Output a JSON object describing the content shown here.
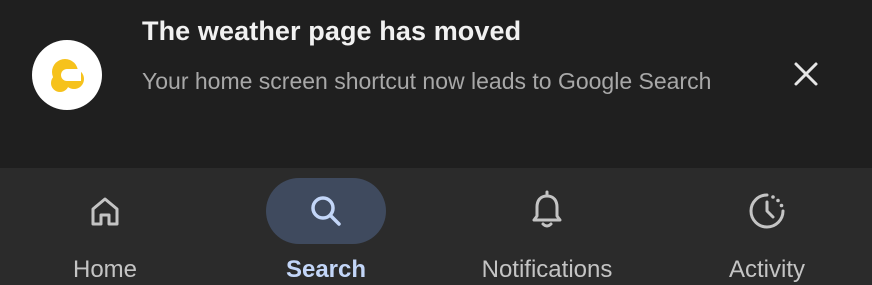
{
  "notification": {
    "app_icon": "weather-sun-cloud-icon",
    "title": "The weather page has moved",
    "body": "Your home screen shortcut now leads to Google Search",
    "close_icon": "close-icon"
  },
  "bottom_nav": {
    "items": [
      {
        "label": "Home",
        "icon": "home-icon",
        "active": false
      },
      {
        "label": "Search",
        "icon": "search-icon",
        "active": true
      },
      {
        "label": "Notifications",
        "icon": "bell-icon",
        "active": false
      },
      {
        "label": "Activity",
        "icon": "activity-clock-icon",
        "active": false
      }
    ]
  },
  "colors": {
    "background": "#1f1f1f",
    "nav_background": "#2b2b2b",
    "active_pill": "#3f4a5e",
    "active_label": "#c3d6f8",
    "icon_yellow": "#f5c518"
  }
}
